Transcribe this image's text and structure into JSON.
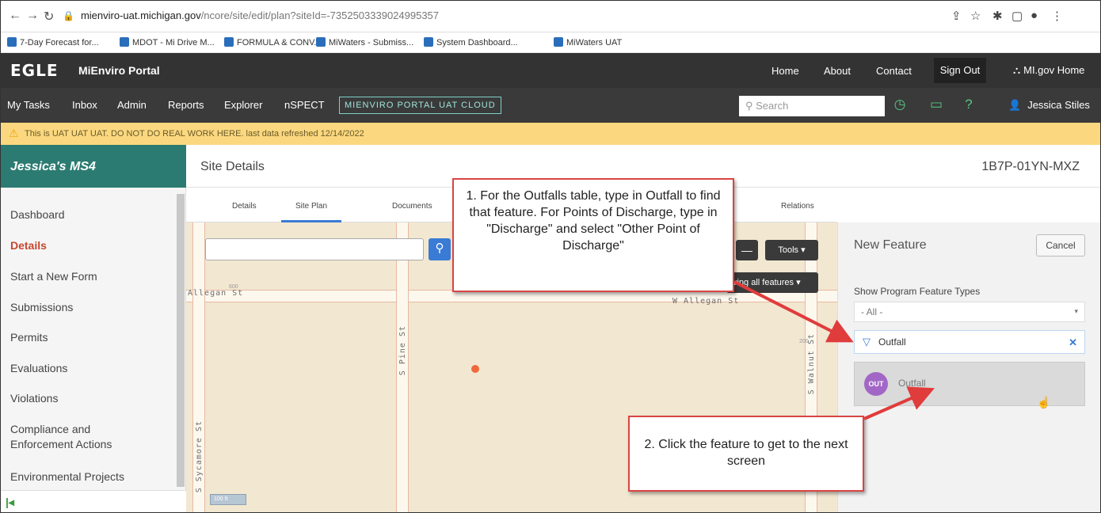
{
  "browser": {
    "url_host": "mienviro-uat.michigan.gov",
    "url_path": "/ncore/site/edit/plan?siteId=-7352503339024995357",
    "bookmarks": [
      "7-Day Forecast for...",
      "MDOT - Mi Drive M...",
      "FORMULA & CONV...",
      "MiWaters - Submiss...",
      "System Dashboard...",
      "MiWaters UAT"
    ]
  },
  "header": {
    "logo": "EGLE",
    "portal": "MiEnviro Portal",
    "links": [
      "Home",
      "About",
      "Contact"
    ],
    "sign_out": "Sign Out",
    "migov": "MI.gov Home"
  },
  "nav": {
    "items": [
      "My Tasks",
      "Inbox",
      "Admin",
      "Reports",
      "Explorer",
      "nSPECT"
    ],
    "badge": "MIENVIRO PORTAL UAT CLOUD",
    "search_placeholder": "Search",
    "user": "Jessica Stiles"
  },
  "banner": {
    "text": "This is UAT UAT UAT. DO NOT DO REAL WORK HERE. last data refreshed 12/14/2022"
  },
  "sidebar": {
    "title": "Jessica's MS4",
    "items": [
      {
        "label": "Dashboard"
      },
      {
        "label": "Details"
      },
      {
        "label": "Start a New Form"
      },
      {
        "label": "Submissions"
      },
      {
        "label": "Permits"
      },
      {
        "label": "Evaluations"
      },
      {
        "label": "Violations"
      },
      {
        "label": "Compliance and Enforcement Actions"
      },
      {
        "label": "Environmental Projects"
      }
    ]
  },
  "content": {
    "title": "Site Details",
    "site_id": "1B7P-01YN-MXZ",
    "tabs": [
      "Details",
      "Site Plan",
      "Documents",
      "Relations"
    ]
  },
  "map": {
    "streets": {
      "allegan": "Allegan St",
      "w_allegan": "W Allegan St",
      "pine": "S Pine St",
      "walnut": "S Walnut St",
      "sycamore": "S Sycamore St"
    },
    "tools_label": "Tools",
    "showing_label": "ving all features",
    "scale": "100 ft",
    "address_hints": [
      "600",
      "200"
    ]
  },
  "feature_panel": {
    "title": "New Feature",
    "cancel": "Cancel",
    "types_label": "Show Program Feature Types",
    "type_value": "- All -",
    "filter_value": "Outfall",
    "item_badge": "OUT",
    "item_name": "Outfall",
    "badge_color": "#a267c6"
  },
  "callouts": {
    "step1": "1. For the Outfalls table, type in Outfall to find that feature.  For Points of Discharge, type in \"Discharge\" and select \"Other Point of Discharge\"",
    "step2": "2. Click the feature to get to the next screen",
    "arrow_color": "#e03c3c"
  }
}
